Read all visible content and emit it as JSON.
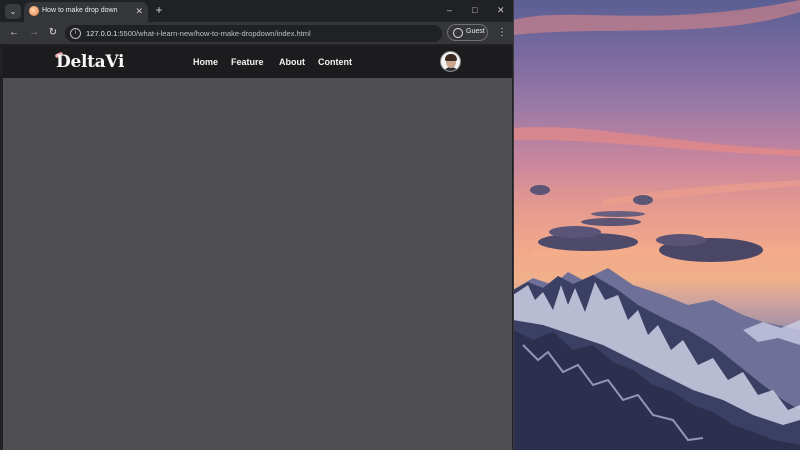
{
  "browser": {
    "tab": {
      "title": "How to make drop down",
      "close_icon": "✕"
    },
    "new_tab_icon": "+",
    "tab_search_icon": "⌄",
    "window_controls": {
      "minimize": "–",
      "maximize": "□",
      "close": "✕"
    },
    "nav": {
      "back": "←",
      "forward": "→",
      "reload": "↻"
    },
    "address": {
      "info_icon": "i",
      "host": "127.0.0.1",
      "rest": ":5500/what-i-learn-new/how-to-make-dropdown/index.html"
    },
    "profile": {
      "label": "Guest"
    },
    "menu_icon": "⋮"
  },
  "site": {
    "logo": "DeltaVi",
    "links": [
      "Home",
      "Feature",
      "About",
      "Content"
    ]
  }
}
